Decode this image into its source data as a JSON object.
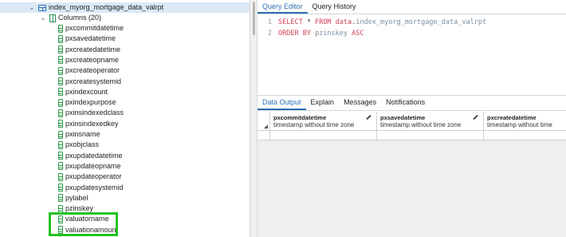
{
  "tree": {
    "table": {
      "name": "index_myorg_mortgage_data_valrpt",
      "icon": "table-icon"
    },
    "columns_group": {
      "label": "Columns (20)",
      "icon": "columns-icon"
    },
    "columns": [
      "pxcommitdatetime",
      "pxsavedatetime",
      "pxcreatedatetime",
      "pxcreateopname",
      "pxcreateoperator",
      "pxcreatesystemid",
      "pxindexcount",
      "pxindexpurpose",
      "pxinsindexedclass",
      "pxinsindexedkey",
      "pxinsname",
      "pxobjclass",
      "pxupdatedatetime",
      "pxupdateopname",
      "pxupdateoperator",
      "pxupdatesystemid",
      "pylabel",
      "pzinskey",
      "valuatorname",
      "valuationamount"
    ],
    "highlight_color": "#22c322"
  },
  "query_tabs": [
    "Query Editor",
    "Query History"
  ],
  "editor": {
    "lines": [
      {
        "num": "1",
        "parts": [
          [
            "kw",
            "SELECT"
          ],
          [
            "sym",
            " * "
          ],
          [
            "kw",
            "FROM"
          ],
          [
            "sym",
            " "
          ],
          [
            "kw",
            "data"
          ],
          [
            "sym",
            "."
          ],
          [
            "tok",
            "index_myorg_mortgage_data_valrpt"
          ]
        ]
      },
      {
        "num": "2",
        "parts": [
          [
            "kw",
            "ORDER BY"
          ],
          [
            "sym",
            " "
          ],
          [
            "tok",
            "pzinskey"
          ],
          [
            "sym",
            " "
          ],
          [
            "kw",
            "ASC"
          ]
        ]
      }
    ]
  },
  "output_tabs": [
    "Data Output",
    "Explain",
    "Messages",
    "Notifications"
  ],
  "grid": {
    "headers": [
      {
        "name": "pxcommitdatetime",
        "type": "timestamp without time zone"
      },
      {
        "name": "pxsavedatetime",
        "type": "timestamp without time zone"
      },
      {
        "name": "pxcreatedatetime",
        "type": "timestamp without time zone"
      }
    ]
  },
  "colors": {
    "accent": "#2b6fb4",
    "keyword": "#d13f57"
  }
}
